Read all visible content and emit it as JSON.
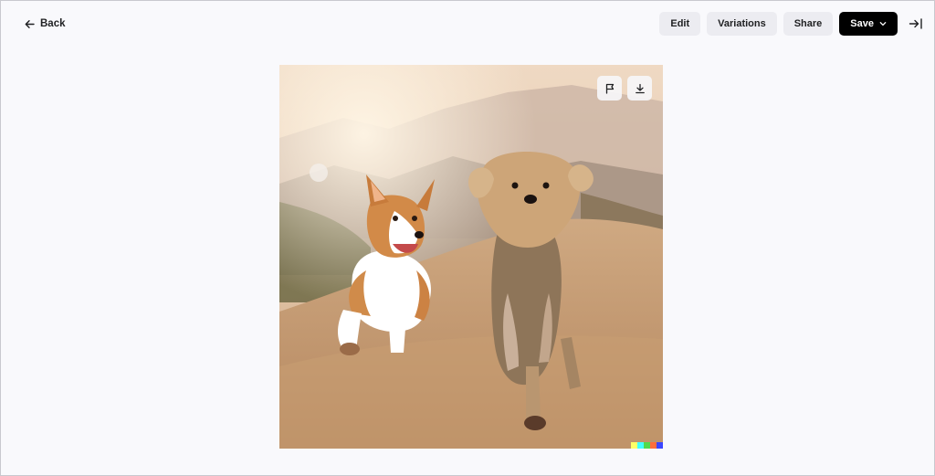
{
  "header": {
    "back_label": "Back",
    "back_icon": "arrow-left-icon",
    "actions": [
      {
        "label": "Edit"
      },
      {
        "label": "Variations"
      },
      {
        "label": "Share"
      }
    ],
    "save_label": "Save",
    "save_icon": "chevron-down-icon",
    "collapse_icon": "collapse-panel-icon"
  },
  "image": {
    "subject": "two dogs running on a dirt path at sunset",
    "overlay_buttons": [
      {
        "icon": "flag-icon"
      },
      {
        "icon": "download-icon"
      }
    ],
    "watermark_colors": [
      "#ffff66",
      "#42ffff",
      "#51da4c",
      "#ff6e3c",
      "#3c46ff"
    ]
  },
  "colors": {
    "background": "#f9f9fc",
    "button_bg": "#ececf1",
    "primary_button_bg": "#000000",
    "text": "#202123"
  }
}
